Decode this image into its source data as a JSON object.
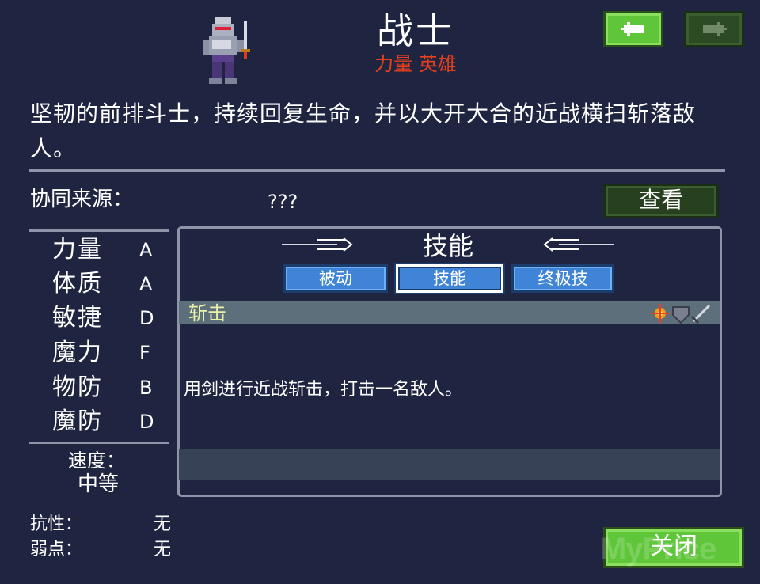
{
  "header": {
    "title": "战士",
    "tags": "力量 英雄"
  },
  "description": "坚韧的前排斗士，持续回复生命，并以大开大合的近战横扫斩落敌人。",
  "synergy": {
    "label": "协同来源：",
    "value": "???",
    "view_button": "查看"
  },
  "stats": [
    {
      "name": "力量",
      "grade": "A"
    },
    {
      "name": "体质",
      "grade": "A"
    },
    {
      "name": "敏捷",
      "grade": "D"
    },
    {
      "name": "魔力",
      "grade": "F"
    },
    {
      "name": "物防",
      "grade": "B"
    },
    {
      "name": "魔防",
      "grade": "D"
    }
  ],
  "speed": {
    "label": "速度：",
    "value": "中等"
  },
  "resistance": {
    "label": "抗性：",
    "value": "无"
  },
  "weakness": {
    "label": "弱点：",
    "value": "无"
  },
  "skills": {
    "heading": "技能",
    "tabs": [
      {
        "label": "被动",
        "active": false
      },
      {
        "label": "技能",
        "active": true
      },
      {
        "label": "终极技",
        "active": false
      }
    ],
    "selected": {
      "name": "斩击",
      "description": "用剑进行近战斩击，打击一名敌人。"
    }
  },
  "close_button": "关闭",
  "watermark": "MyPrice",
  "colors": {
    "background": "#1f2540",
    "accent_green": "#5fc63a",
    "tag_red": "#e8401c",
    "tab_blue": "#3f84d6"
  },
  "icons": [
    "knight-sprite",
    "arrow-left-icon",
    "arrow-right-icon",
    "fire-icon",
    "shield-icon",
    "sword-icon"
  ]
}
